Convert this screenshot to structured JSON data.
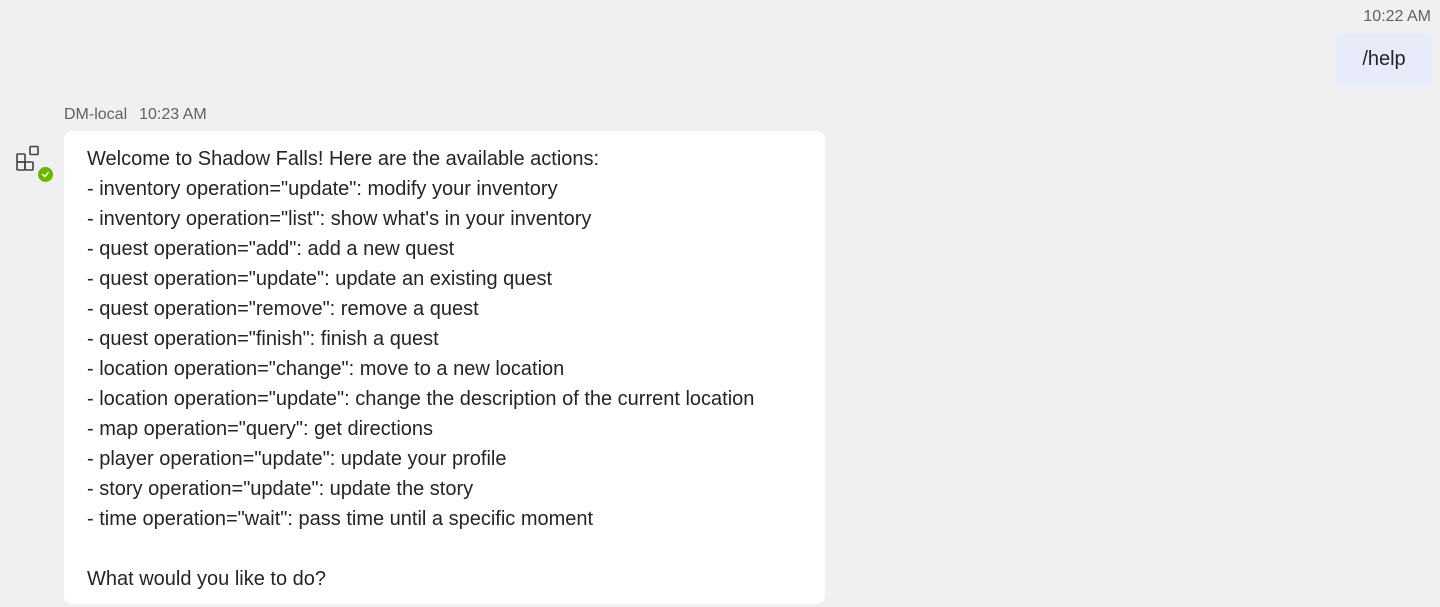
{
  "outgoing": {
    "time": "10:22 AM",
    "text": "/help"
  },
  "incoming": {
    "sender": "DM-local",
    "time": "10:23 AM",
    "avatar_icon": "apps-grid-icon",
    "status_icon": "available-check-icon",
    "status_color": "#6bb700",
    "intro": "Welcome to Shadow Falls! Here are the available actions:",
    "actions": [
      "- inventory operation=\"update\": modify your inventory",
      "- inventory operation=\"list\": show what's in your inventory",
      "- quest operation=\"add\": add a new quest",
      "- quest operation=\"update\": update an existing quest",
      "- quest operation=\"remove\": remove a quest",
      "- quest operation=\"finish\": finish a quest",
      "- location operation=\"change\": move to a new location",
      "- location operation=\"update\": change the description of the current location",
      "- map operation=\"query\": get directions",
      "- player operation=\"update\": update your profile",
      "- story operation=\"update\": update the story",
      "- time operation=\"wait\": pass time until a specific moment"
    ],
    "closing": "What would you like to do?"
  },
  "colors": {
    "background": "#f0f0f0",
    "outgoing_bubble": "#e8ebfa",
    "incoming_bubble": "#ffffff"
  }
}
